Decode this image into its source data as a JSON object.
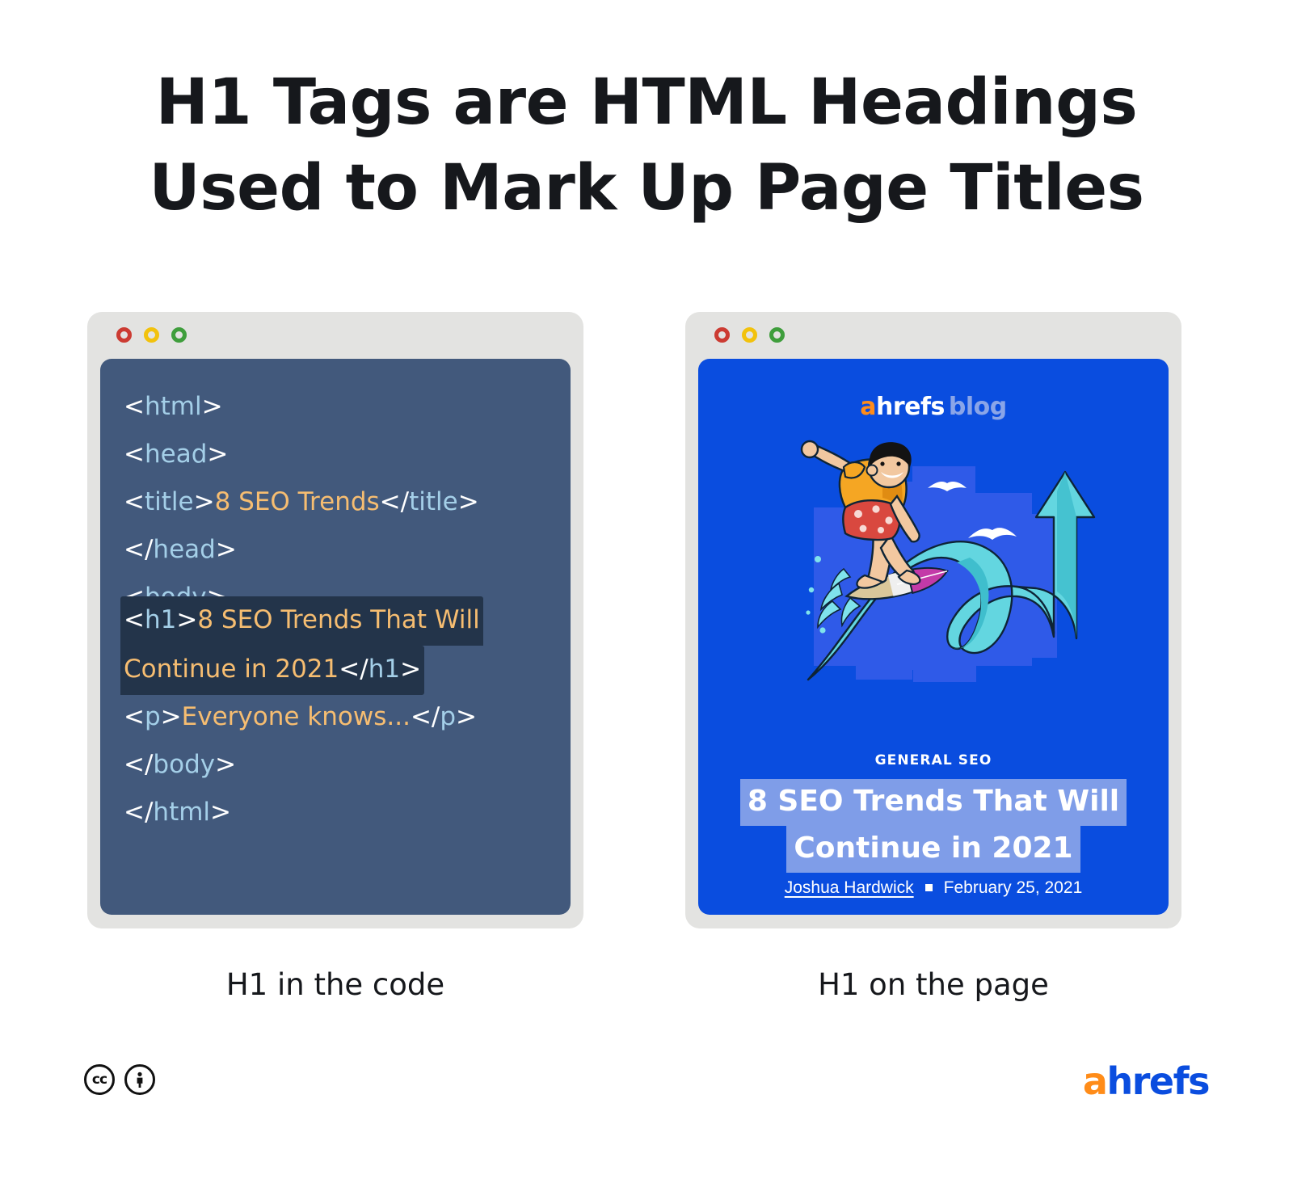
{
  "title": "H1 Tags are HTML Headings\nUsed to Mark Up Page Titles",
  "colors": {
    "background": "#ffffff",
    "window_frame": "#e3e3e1",
    "code_panel": "#42597c",
    "code_highlight": "#23344a",
    "blog_panel": "#0a4ddf",
    "blog_title_highlight": "#7f9de8",
    "tag_blue": "#a4cfe8",
    "code_text_orange": "#f6bd71",
    "brand_orange": "#ff8c19",
    "brand_blue": "#0a4ddf",
    "dot_red": "#cc3b32",
    "dot_yellow": "#f2c20d",
    "dot_green": "#3f9e3c"
  },
  "left_window": {
    "dots": [
      "close-dot",
      "minimize-dot",
      "maximize-dot"
    ],
    "code_lines": [
      {
        "brk1": "<",
        "tag1": "html",
        "brk2": ">",
        "text": "",
        "brk3": "",
        "tag2": "",
        "brk4": ""
      },
      {
        "brk1": "<",
        "tag1": "head",
        "brk2": ">",
        "text": "",
        "brk3": "",
        "tag2": "",
        "brk4": ""
      },
      {
        "brk1": "<",
        "tag1": "title",
        "brk2": ">",
        "text": "8 SEO Trends",
        "brk3": "</",
        "tag2": "title",
        "brk4": ">"
      },
      {
        "brk1": "</",
        "tag1": "head",
        "brk2": ">",
        "text": "",
        "brk3": "",
        "tag2": "",
        "brk4": ""
      },
      {
        "brk1": "<",
        "tag1": "body",
        "brk2": ">",
        "text": "",
        "brk3": "",
        "tag2": "",
        "brk4": ""
      }
    ],
    "highlighted_lines": {
      "line1": {
        "brk1": "<",
        "tag1": "h1",
        "brk2": ">",
        "text": "8 SEO Trends That Will"
      },
      "line2": {
        "text": "Continue in 2021",
        "brk3": "</",
        "tag2": "h1",
        "brk4": ">"
      }
    },
    "code_lines_after": [
      {
        "brk1": "<",
        "tag1": "p",
        "brk2": ">",
        "text": "Everyone knows...",
        "brk3": "</",
        "tag2": "p",
        "brk4": ">"
      },
      {
        "brk1": "</",
        "tag1": "body",
        "brk2": ">",
        "text": "",
        "brk3": "",
        "tag2": "",
        "brk4": ""
      },
      {
        "brk1": "</",
        "tag1": "html",
        "brk2": ">",
        "text": "",
        "brk3": "",
        "tag2": "",
        "brk4": ""
      }
    ],
    "caption": "H1 in the code"
  },
  "right_window": {
    "dots": [
      "close-dot",
      "minimize-dot",
      "maximize-dot"
    ],
    "logo": {
      "a": "a",
      "hrefs": "hrefs",
      "blog": "blog"
    },
    "illustration": "surfer-riding-growth-arrow-illustration",
    "category": "GENERAL SEO",
    "post_title_line1": "8 SEO Trends That Will",
    "post_title_line2": "Continue in 2021",
    "author": "Joshua Hardwick",
    "date": "February 25, 2021",
    "caption": "H1 on the page"
  },
  "footer": {
    "cc_badge": "cc",
    "by_badge": "i",
    "logo_a": "a",
    "logo_hrefs": "hrefs"
  }
}
